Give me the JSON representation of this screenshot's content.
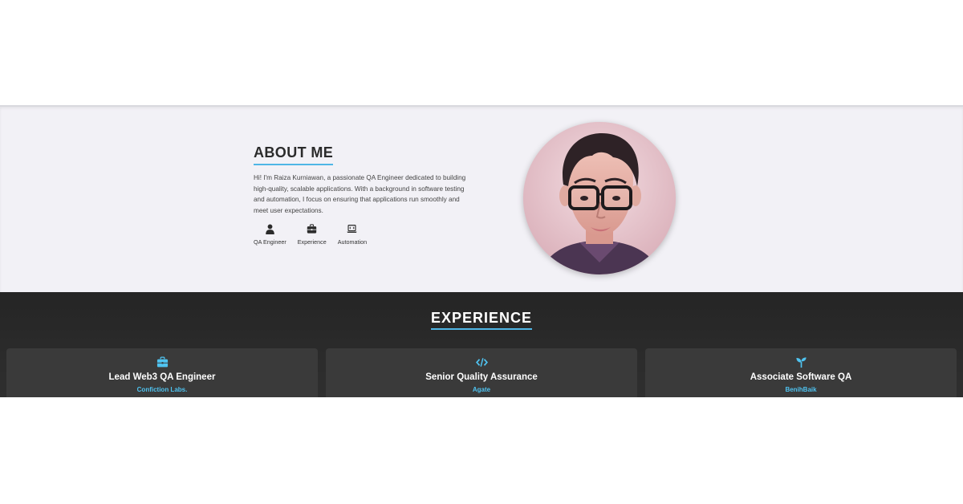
{
  "about": {
    "title": "ABOUT ME",
    "description": "Hi! I'm Raiza Kurniawan, a passionate QA Engineer dedicated to building high-quality, scalable applications. With a background in software testing and automation, I focus on ensuring that applications run smoothly and meet user expectations.",
    "highlights": [
      {
        "icon": "user-icon",
        "label": "QA Engineer"
      },
      {
        "icon": "briefcase-icon",
        "label": "Experience"
      },
      {
        "icon": "laptop-code-icon",
        "label": "Automation"
      }
    ],
    "avatar": "profile-photo"
  },
  "experience": {
    "title": "EXPERIENCE",
    "cards": [
      {
        "icon": "briefcase-icon",
        "role": "Lead Web3 QA Engineer",
        "company": "Confiction Labs."
      },
      {
        "icon": "code-icon",
        "role": "Senior Quality Assurance",
        "company": "Agate"
      },
      {
        "icon": "seedling-icon",
        "role": "Associate Software QA",
        "company": "BenihBaik"
      }
    ]
  },
  "colors": {
    "accent": "#4fb6e6",
    "about_bg": "#f2f1f6",
    "experience_bg": "#2a2a2a",
    "card_bg": "#3a3a3a",
    "company_text": "#4fc3f0"
  }
}
